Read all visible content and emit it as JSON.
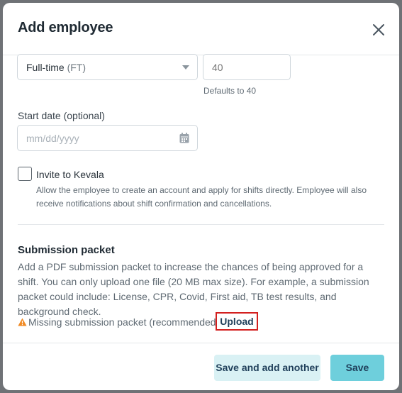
{
  "modal": {
    "title": "Add employee",
    "close_icon": "close-icon"
  },
  "employment": {
    "type_value": "Full-time",
    "type_abbr": "(FT)",
    "hours_placeholder": "40",
    "hours_hint": "Defaults to 40"
  },
  "start_date": {
    "label": "Start date (optional)",
    "placeholder": "mm/dd/yyyy",
    "icon": "calendar-icon"
  },
  "invite": {
    "label": "Invite to Kevala",
    "checked": false,
    "description": "Allow the employee to create an account and apply for shifts directly. Employee will also receive notifications about shift confirmation and cancellations."
  },
  "submission": {
    "title": "Submission packet",
    "description": "Add a PDF submission packet to increase the chances of being approved for a shift. You can only upload one file (20 MB max size). For example, a submission packet could include: License, CPR, Covid, First aid, TB test results, and background check.",
    "warning_icon": "warning-icon",
    "warning_text": "Missing submission packet (recommended)",
    "upload_label": "Upload"
  },
  "footer": {
    "save_and_add_label": "Save and add another",
    "save_label": "Save"
  },
  "colors": {
    "primary": "#6ecfdc",
    "secondary": "#d9f1f4",
    "highlight": "#d3201f",
    "warning": "#f08a24"
  }
}
